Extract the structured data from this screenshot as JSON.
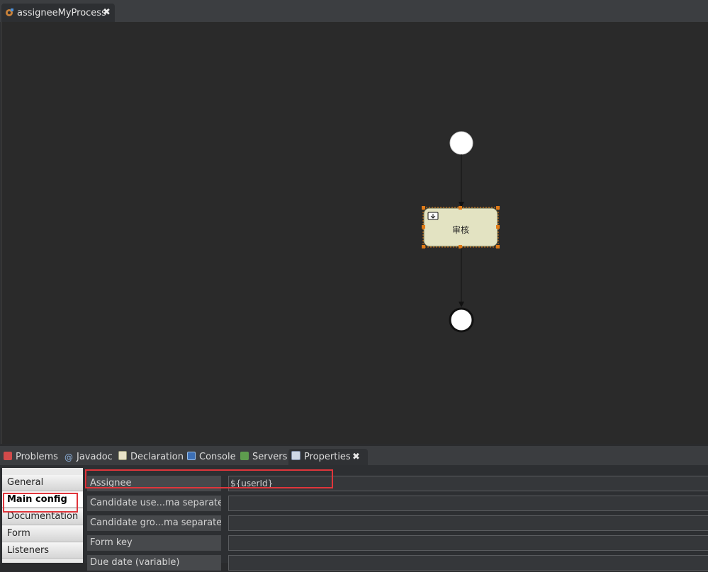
{
  "editor": {
    "tab_title": "assigneeMyProcess",
    "tab_icon": "process-diagram-icon"
  },
  "diagram": {
    "task_label": "审核",
    "task_icon": "user-task-icon",
    "colors": {
      "canvas_bg": "#2a2a2a",
      "task_fill": "#e3e3c2",
      "selection_handles": "#e07b17",
      "event_fill": "#ffffff"
    }
  },
  "views": {
    "tabs": [
      {
        "label": "Problems",
        "icon": "problems-icon"
      },
      {
        "label": "Javadoc",
        "icon": "javadoc-icon"
      },
      {
        "label": "Declaration",
        "icon": "declaration-icon"
      },
      {
        "label": "Console",
        "icon": "console-icon"
      },
      {
        "label": "Servers",
        "icon": "servers-icon"
      },
      {
        "label": "Properties",
        "icon": "properties-icon",
        "active": true
      }
    ]
  },
  "properties": {
    "sidebar": [
      {
        "label": "General"
      },
      {
        "label": "Main config",
        "selected": true
      },
      {
        "label": "Documentation"
      },
      {
        "label": "Form"
      },
      {
        "label": "Listeners"
      }
    ],
    "fields": [
      {
        "label": "Assignee",
        "value": "${userId}"
      },
      {
        "label": "Candidate use...ma separated)",
        "value": ""
      },
      {
        "label": "Candidate gro...ma separated)",
        "value": ""
      },
      {
        "label": "Form key",
        "value": ""
      },
      {
        "label": "Due date (variable)",
        "value": ""
      }
    ],
    "highlight_color": "#e0353b"
  }
}
